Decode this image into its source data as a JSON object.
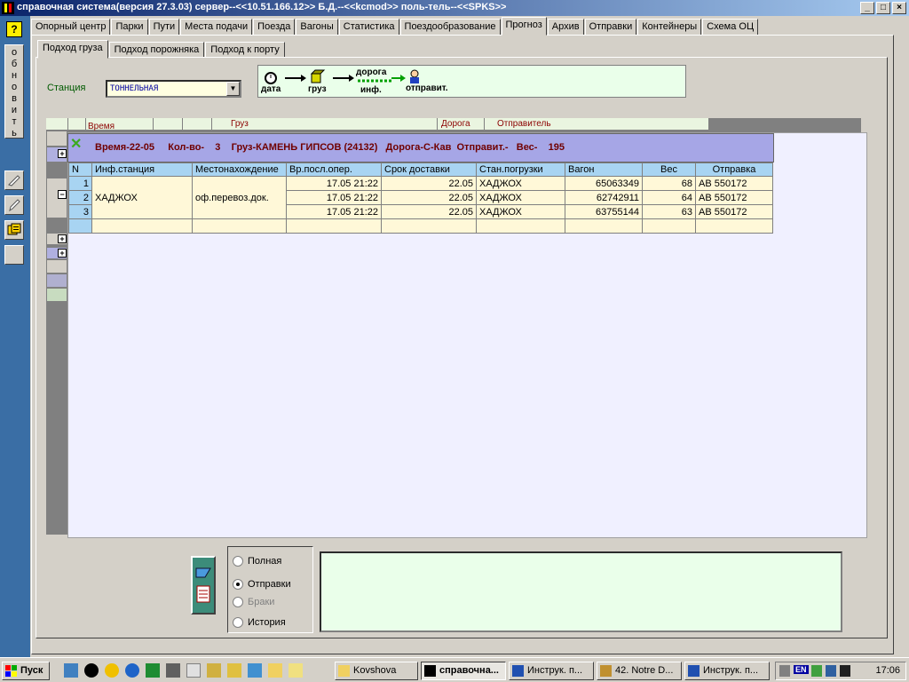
{
  "window": {
    "title": "справочная система(версия 27.3.03) сервер--<<10.51.166.12>> Б.Д.--<<kcmod>> поль-тель--<<SPKS>>",
    "min_glyph": "_",
    "max_glyph": "□",
    "close_glyph": "×"
  },
  "left_toolbar": {
    "help_label": "?",
    "refresh_label": [
      "о",
      "б",
      "н",
      "о",
      "в",
      "и",
      "т",
      "ь"
    ]
  },
  "main_tabs": [
    "Опорный центр",
    "Парки",
    "Пути",
    "Места подачи",
    "Поезда",
    "Вагоны",
    "Статистика",
    "Поездообразование",
    "Прогноз",
    "Архив",
    "Отправки",
    "Контейнеры",
    "Схема ОЦ"
  ],
  "main_tab_active": "Прогноз",
  "sub_tabs": [
    "Подход груза",
    "Подход порожняка",
    "Подход к порту"
  ],
  "sub_tab_active": "Подход груза",
  "station": {
    "label": "Станция",
    "value": "ТОННЕЛЬНАЯ"
  },
  "legend": {
    "date": "дата",
    "cargo": "груз",
    "road": "дорога",
    "info": "инф.",
    "sender": "отправит."
  },
  "grid_header": {
    "time": "Время",
    "cargo": "Груз",
    "road": "Дорога",
    "sender": "Отправитель"
  },
  "detail": {
    "title": "Время-22-05     Кол-во-    3    Груз-КАМЕНЬ ГИПСОВ (24132)   Дорога-С-Кав  Отправит.-   Вес-    195",
    "columns": [
      "N",
      "Инф.станция",
      "Местонахождение",
      "Вр.посл.опер.",
      "Срок доставки",
      "Стан.погрузки",
      "Вагон",
      "Вес",
      "Отправка"
    ],
    "rows": [
      {
        "n": "1",
        "station": "",
        "location": "",
        "last_op": "17.05 21:22",
        "due": "22.05",
        "load_station": "ХАДЖОХ",
        "wagon": "65063349",
        "weight": "68",
        "shipment": "АВ 550172"
      },
      {
        "n": "2",
        "station": "ХАДЖОХ",
        "location": "оф.перевоз.док.",
        "last_op": "17.05 21:22",
        "due": "22.05",
        "load_station": "ХАДЖОХ",
        "wagon": "62742911",
        "weight": "64",
        "shipment": "АВ 550172"
      },
      {
        "n": "3",
        "station": "",
        "location": "",
        "last_op": "17.05 21:22",
        "due": "22.05",
        "load_station": "ХАДЖОХ",
        "wagon": "63755144",
        "weight": "63",
        "shipment": "АВ 550172"
      }
    ]
  },
  "radio": {
    "options": [
      {
        "label": "Полная",
        "checked": false,
        "disabled": false
      },
      {
        "label": "Отправки",
        "checked": true,
        "disabled": false
      },
      {
        "label": "Браки",
        "checked": false,
        "disabled": true
      },
      {
        "label": "История",
        "checked": false,
        "disabled": false
      }
    ]
  },
  "taskbar": {
    "start": "Пуск",
    "tasks": [
      "Kovshova",
      "справочна...",
      "Инструк. п...",
      "42. Notre D...",
      "Инструк. п..."
    ],
    "lang": "EN",
    "clock": "17:06"
  },
  "colors": {
    "titlebar": "#0a246a",
    "desktop": "#3a6ea5",
    "detail_header": "#a6a6e6",
    "table_header": "#a8d4f2",
    "table_cell": "#fff8d8",
    "legend_bg": "#eaffea"
  }
}
